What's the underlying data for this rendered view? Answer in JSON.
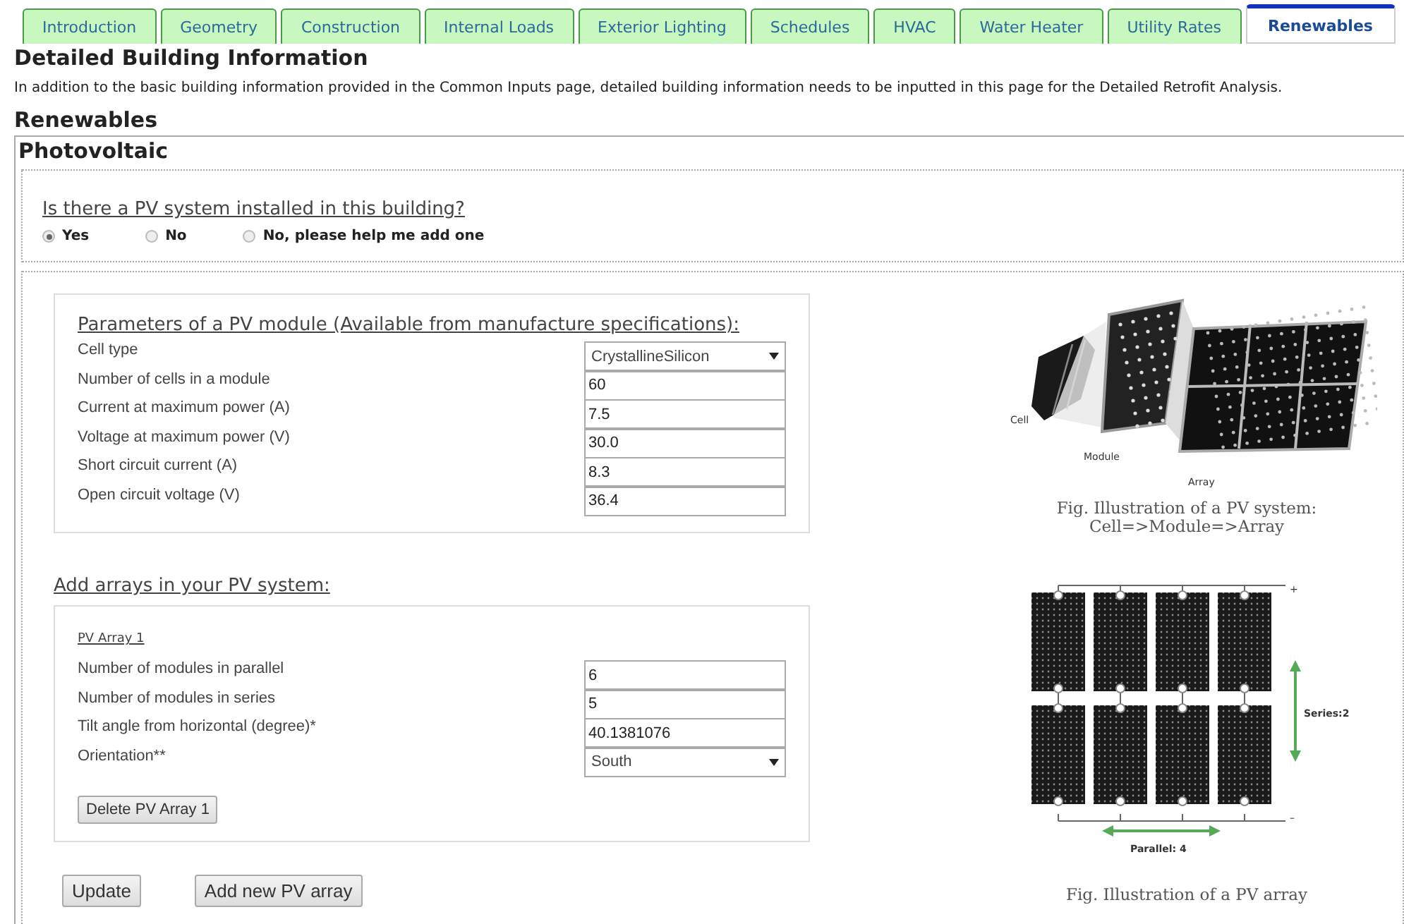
{
  "tabs": [
    {
      "label": "Introduction",
      "selected": false
    },
    {
      "label": "Geometry",
      "selected": false
    },
    {
      "label": "Construction",
      "selected": false
    },
    {
      "label": "Internal Loads",
      "selected": false
    },
    {
      "label": "Exterior Lighting",
      "selected": false
    },
    {
      "label": "Schedules",
      "selected": false
    },
    {
      "label": "HVAC",
      "selected": false
    },
    {
      "label": "Water Heater",
      "selected": false
    },
    {
      "label": "Utility Rates",
      "selected": false
    },
    {
      "label": "Renewables",
      "selected": true
    }
  ],
  "page_title": "Detailed Building Information",
  "intro": "In addition to the basic building information provided in the Common Inputs page, detailed building information needs to be inputted in this page for the Detailed Retrofit Analysis.",
  "section_title": "Renewables",
  "panel_title": "Photovoltaic",
  "question": {
    "text": "Is there a PV system installed in this building?",
    "options": [
      {
        "label": "Yes",
        "selected": true
      },
      {
        "label": "No",
        "selected": false
      },
      {
        "label": "No, please help me add one",
        "selected": false
      }
    ]
  },
  "module": {
    "title": "Parameters of a PV module (Available from manufacture specifications):",
    "fields": [
      {
        "kind": "select",
        "label": "Cell type",
        "value": "CrystallineSilicon"
      },
      {
        "kind": "text",
        "label": "Number of cells in a module",
        "value": "60"
      },
      {
        "kind": "text",
        "label": "Current at maximum power (A)",
        "value": "7.5"
      },
      {
        "kind": "text",
        "label": "Voltage at maximum power (V)",
        "value": "30.0"
      },
      {
        "kind": "text",
        "label": "Short circuit current (A)",
        "value": "8.3"
      },
      {
        "kind": "text",
        "label": "Open circuit voltage (V)",
        "value": "36.4"
      }
    ]
  },
  "arrays_title": "Add arrays in your PV system:",
  "arrays": [
    {
      "title": "PV Array 1",
      "fields": [
        {
          "kind": "text",
          "label": "Number of modules in parallel",
          "value": "6"
        },
        {
          "kind": "text",
          "label": "Number of modules in series",
          "value": "5"
        },
        {
          "kind": "text",
          "label": "Tilt angle from horizontal (degree)*",
          "value": "40.1381076"
        },
        {
          "kind": "select",
          "label": "Orientation**",
          "value": "South"
        }
      ],
      "delete_button": "Delete PV Array 1"
    }
  ],
  "buttons": [
    "Update",
    "Add new PV array"
  ],
  "figure_system": {
    "labels": [
      "Cell",
      "Module",
      "Array"
    ],
    "caption": [
      "Fig. Illustration of a PV system:",
      "Cell=>Module=>Array"
    ]
  },
  "figure_array": {
    "plus": "+",
    "minus": "–",
    "series": "Series:2",
    "parallel": "Parallel: 4",
    "caption": "Fig. Illustration of a PV array"
  }
}
